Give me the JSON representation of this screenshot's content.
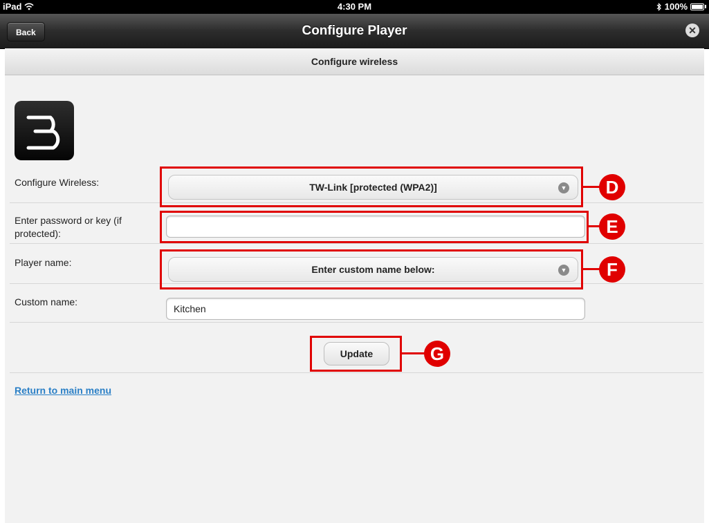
{
  "status_bar": {
    "device": "iPad",
    "time": "4:30 PM",
    "battery": "100%"
  },
  "nav": {
    "back_label": "Back",
    "title": "Configure Player"
  },
  "subheader": {
    "title": "Configure wireless"
  },
  "form": {
    "wireless_label": "Configure Wireless:",
    "wireless_value": "TW-Link [protected (WPA2)]",
    "password_label": "Enter password or key (if protected):",
    "password_value": "",
    "player_name_label": "Player name:",
    "player_name_value": "Enter custom name below:",
    "custom_name_label": "Custom name:",
    "custom_name_value": "Kitchen",
    "update_label": "Update"
  },
  "return_link": "Return to main menu",
  "annotations": {
    "d": "D",
    "e": "E",
    "f": "F",
    "g": "G"
  },
  "colors": {
    "annotation": "#e00000",
    "link": "#2a7fc6"
  }
}
